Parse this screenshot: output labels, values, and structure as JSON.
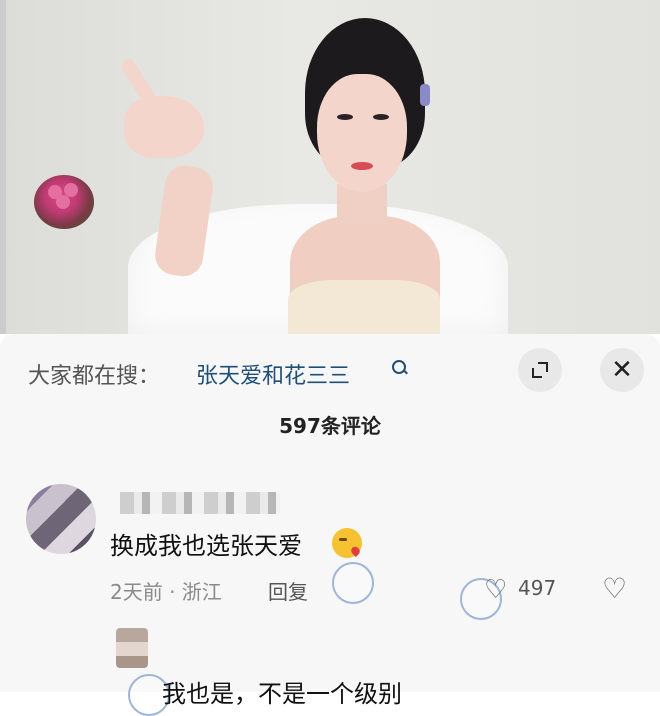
{
  "search": {
    "prefix": "大家都在搜：",
    "term": "张天爱和花三三",
    "expand_icon": "expand-icon",
    "close_icon": "close-icon",
    "close_glyph": "✕"
  },
  "comments_header": {
    "count": "597条评论"
  },
  "comment": {
    "text": "换成我也选张天爱",
    "emoji": "kissing-heart-emoji",
    "meta": "2天前 · 浙江",
    "reply_label": "回复",
    "like_glyph": "♡",
    "likes": "497",
    "dislike_glyph": "♡"
  },
  "reply": {
    "text": "我也是，不是一个级别"
  },
  "colors": {
    "search_term": "#1f4f78",
    "panel_bg": "#f7f7f7",
    "meta_gray": "#8a8a8a"
  }
}
